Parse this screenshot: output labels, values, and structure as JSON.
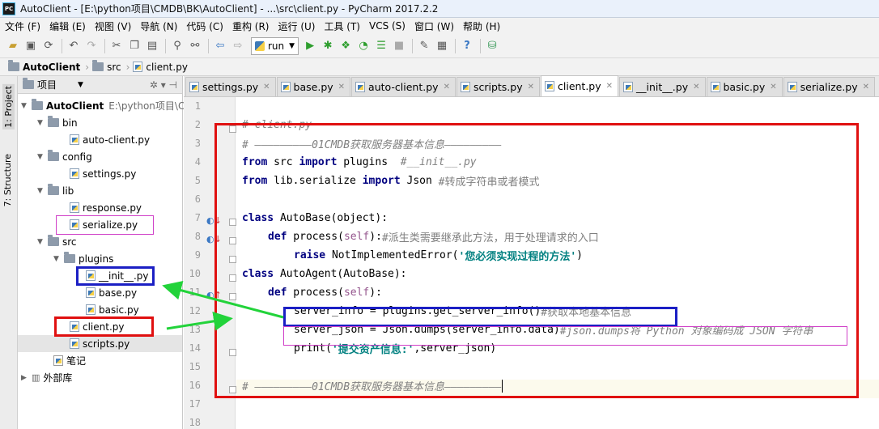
{
  "window": {
    "title": "AutoClient - [E:\\python项目\\CMDB\\BK\\AutoClient] - ...\\src\\client.py - PyCharm 2017.2.2",
    "logo": "PC"
  },
  "menu": [
    "文件 (F)",
    "编辑 (E)",
    "视图 (V)",
    "导航 (N)",
    "代码 (C)",
    "重构 (R)",
    "运行 (U)",
    "工具 (T)",
    "VCS (S)",
    "窗口 (W)",
    "帮助 (H)"
  ],
  "toolbar": {
    "run_config": "run"
  },
  "breadcrumb": [
    "AutoClient",
    "src",
    "client.py"
  ],
  "side_tabs": {
    "project": "1: Project",
    "structure": "7: Structure"
  },
  "project_panel": {
    "header": "项目",
    "root_path": "E:\\python项目\\C",
    "tree": [
      "AutoClient",
      "bin",
      "auto-client.py",
      "config",
      "settings.py",
      "lib",
      "response.py",
      "serialize.py",
      "src",
      "plugins",
      "__init__.py",
      "base.py",
      "basic.py",
      "client.py",
      "scripts.py",
      "笔记",
      "外部库"
    ]
  },
  "tabs": [
    "settings.py",
    "base.py",
    "auto-client.py",
    "scripts.py",
    "client.py",
    "__init__.py",
    "basic.py",
    "serialize.py"
  ],
  "active_tab": "client.py",
  "line_numbers": [
    "1",
    "2",
    "3",
    "4",
    "5",
    "6",
    "7",
    "8",
    "9",
    "10",
    "11",
    "12",
    "13",
    "14",
    "15",
    "16",
    "17",
    "18"
  ],
  "code": {
    "l2": "# client.py",
    "l3": "# ―――――――――01CMDB获取服务器基本信息―――――――――",
    "l4_kw1": "from",
    "l4_mod": " src ",
    "l4_kw2": "import",
    "l4_name": " plugins  ",
    "l4_cm": "#__init__.py",
    "l5_kw1": "from",
    "l5_mod": " lib.serialize ",
    "l5_kw2": "import",
    "l5_name": " Json ",
    "l5_cm": "#转成字符串或者模式",
    "l7_kw": "class",
    "l7_rest": " AutoBase(object):",
    "l8_kw": "def",
    "l8_name": " process(",
    "l8_self": "self",
    "l8_end": "):",
    "l8_cm": "#派生类需要继承此方法，用于处理请求的入口",
    "l9_kw": "raise",
    "l9_name": " NotImplementedError(",
    "l9_str": "'您必须实现过程的方法'",
    "l9_end": ")",
    "l10_kw": "class",
    "l10_rest": " AutoAgent(AutoBase):",
    "l11_kw": "def",
    "l11_name": " process(",
    "l11_self": "self",
    "l11_end": "):",
    "l12_code": "server_info = plugins.get_server_info()",
    "l12_cm": "#获取本地基本信息",
    "l13_code": "server_json = Json.dumps(server_info.data)",
    "l13_cm": "#json.dumps将 Python 对象编码成 JSON 字符串",
    "l14_name": "print(",
    "l14_str": "'提交资产信息:'",
    "l14_end": ",server_json)",
    "l16": "# ―――――――――01CMDB获取服务器基本信息―――――――――"
  },
  "colors": {
    "red_box": "#e01010",
    "blue_box": "#1b1fc4",
    "magenta_box": "#d040c8",
    "green_arrow": "#22d33a"
  }
}
